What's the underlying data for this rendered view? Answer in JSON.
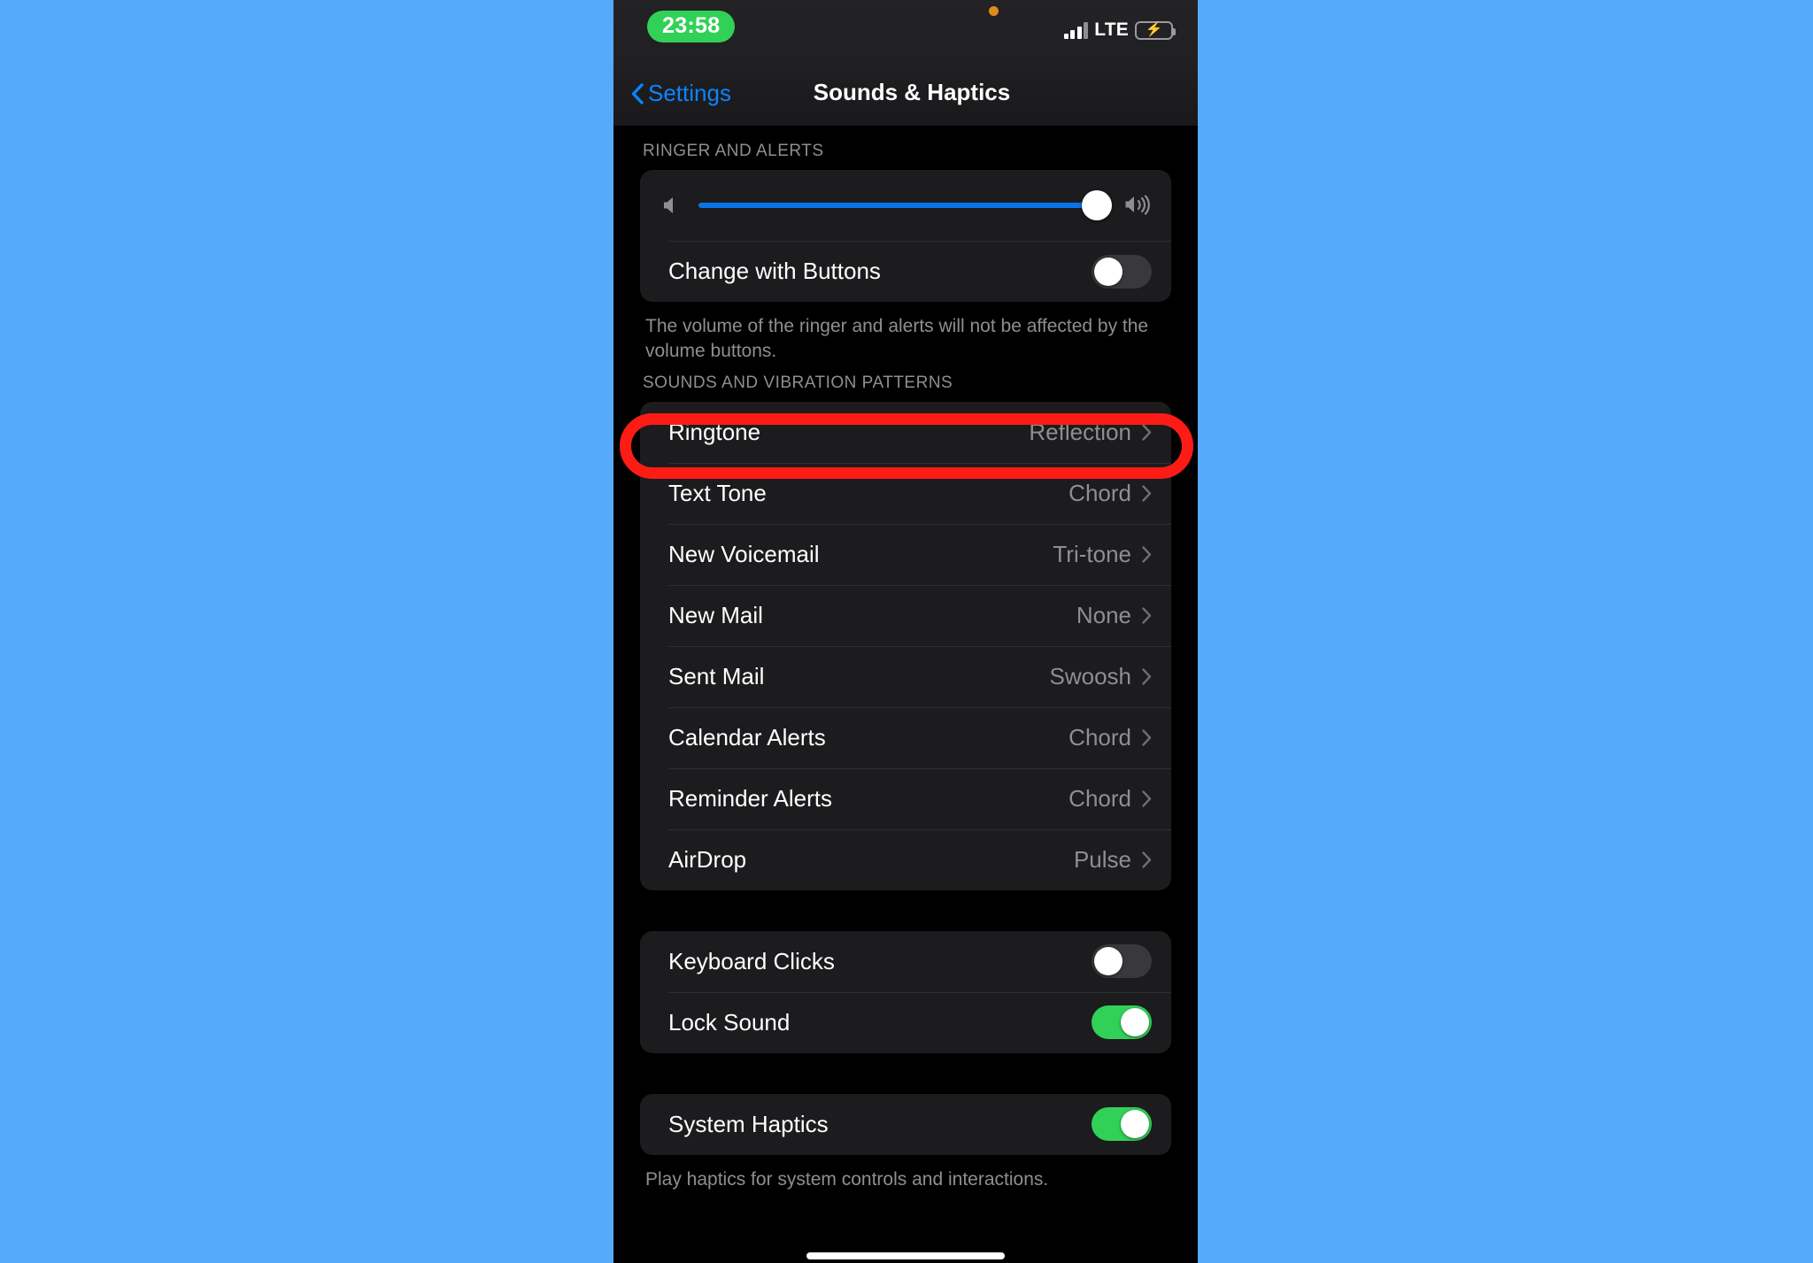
{
  "statusbar": {
    "time": "23:58",
    "carrier_label": "LTE",
    "signal_icon": "cellular-bars-icon",
    "battery_icon": "battery-charging-icon",
    "recording_dot_icon": "orange-privacy-dot-icon",
    "time_pill_color": "#31d158",
    "battery_color": "#31d158"
  },
  "navbar": {
    "back_label": "Settings",
    "back_icon": "chevron-left-icon",
    "title": "Sounds & Haptics",
    "accent_color": "#0b84ff"
  },
  "sections": {
    "ringer": {
      "header": "RINGER AND ALERTS",
      "slider": {
        "value": 97,
        "min_icon": "speaker-low-icon",
        "max_icon": "speaker-high-icon",
        "fill_color": "#0b74e8"
      },
      "change_with_buttons": {
        "label": "Change with Buttons",
        "state": "off"
      },
      "footnote": "The volume of the ringer and alerts will not be affected by the volume buttons."
    },
    "sounds": {
      "header": "SOUNDS AND VIBRATION PATTERNS",
      "rows": [
        {
          "label": "Ringtone",
          "value": "Reflection",
          "highlighted": true
        },
        {
          "label": "Text Tone",
          "value": "Chord",
          "highlighted": false
        },
        {
          "label": "New Voicemail",
          "value": "Tri-tone",
          "highlighted": false
        },
        {
          "label": "New Mail",
          "value": "None",
          "highlighted": false
        },
        {
          "label": "Sent Mail",
          "value": "Swoosh",
          "highlighted": false
        },
        {
          "label": "Calendar Alerts",
          "value": "Chord",
          "highlighted": false
        },
        {
          "label": "Reminder Alerts",
          "value": "Chord",
          "highlighted": false
        },
        {
          "label": "AirDrop",
          "value": "Pulse",
          "highlighted": false
        }
      ]
    },
    "clicks": {
      "rows": [
        {
          "label": "Keyboard Clicks",
          "state": "off"
        },
        {
          "label": "Lock Sound",
          "state": "on"
        }
      ]
    },
    "haptics": {
      "rows": [
        {
          "label": "System Haptics",
          "state": "on"
        }
      ],
      "footnote": "Play haptics for system controls and interactions."
    }
  },
  "annotation": {
    "highlight_color": "#fd1c15",
    "target": "Ringtone"
  },
  "background_color": "#57a9fb"
}
